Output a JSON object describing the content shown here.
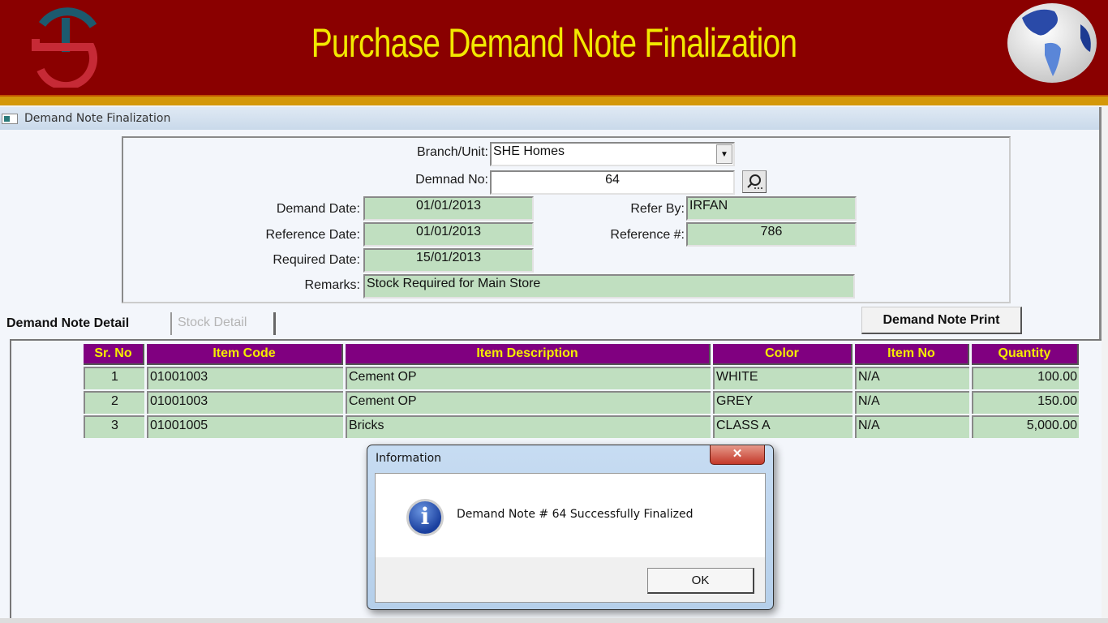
{
  "banner": {
    "title": "Purchase Demand Note Finalization",
    "colors": {
      "background": "#8a0000",
      "stripe": "#d4980a",
      "title": "#f2e800"
    },
    "logo_icon": "ts-logo-icon",
    "globe_icon": "globe-icon"
  },
  "window": {
    "title": "Demand Note Finalization",
    "icon": "window-icon"
  },
  "form": {
    "branch_label": "Branch/Unit:",
    "branch_value": "SHE Homes",
    "demand_no_label": "Demnad No:",
    "demand_no_value": "64",
    "demand_date_label": "Demand Date:",
    "demand_date_value": "01/01/2013",
    "reference_date_label": "Reference Date:",
    "reference_date_value": "01/01/2013",
    "required_date_label": "Required Date:",
    "required_date_value": "15/01/2013",
    "refer_by_label": "Refer By:",
    "refer_by_value": "IRFAN",
    "reference_no_label": "Reference #:",
    "reference_no_value": "786",
    "remarks_label": "Remarks:",
    "remarks_value": "Stock Required for Main Store"
  },
  "tabs": [
    {
      "label": "Demand Note Detail",
      "active": true
    },
    {
      "label": "Stock Detail",
      "active": false
    }
  ],
  "print_button": "Demand Note Print",
  "grid": {
    "columns": [
      "Sr. No",
      "Item Code",
      "Item Description",
      "Color",
      "Item No",
      "Quantity"
    ],
    "rows": [
      {
        "sr": "1",
        "code": "01001003",
        "desc": "Cement OP",
        "color": "WHITE",
        "item_no": "N/A",
        "qty": "100.00"
      },
      {
        "sr": "2",
        "code": "01001003",
        "desc": "Cement OP",
        "color": "GREY",
        "item_no": "N/A",
        "qty": "150.00"
      },
      {
        "sr": "3",
        "code": "01001005",
        "desc": "Bricks",
        "color": "CLASS A",
        "item_no": "N/A",
        "qty": "5,000.00"
      }
    ],
    "colors": {
      "header_bg": "#800080",
      "header_text": "#f5ec00",
      "cell_bg": "#c0dfc0"
    }
  },
  "dialog": {
    "title": "Information",
    "close": "✕",
    "icon": "i",
    "message": "Demand Note # 64 Successfully Finalized",
    "ok": "OK"
  }
}
